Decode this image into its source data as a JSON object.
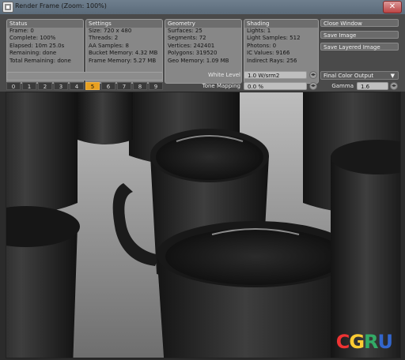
{
  "window": {
    "title": "Render Frame (Zoom: 100%)",
    "close_glyph": "✕"
  },
  "status": {
    "header": "Status",
    "rows": [
      "Frame: 0",
      "Complete: 100%",
      "Elapsed: 10m 25.0s",
      "Remaining: done",
      "Total Remaining: done"
    ]
  },
  "settings": {
    "header": "Settings",
    "rows": [
      "Size: 720 x 480",
      "Threads: 2",
      "AA Samples: 8",
      "Bucket Memory: 4.32 MB",
      "Frame Memory: 5.27 MB"
    ]
  },
  "geometry": {
    "header": "Geometry",
    "rows": [
      "Surfaces: 25",
      "Segments: 72",
      "Vertices: 242401",
      "Polygons: 319520",
      "Geo Memory: 1.09 MB"
    ]
  },
  "shading": {
    "header": "Shading",
    "rows": [
      "Lights: 1",
      "Light Samples: 512",
      "Photons: 0",
      "IC Values: 9166",
      "Indirect Rays: 256"
    ]
  },
  "buttons": {
    "close_window": "Close Window",
    "save_image": "Save Image",
    "save_layered_image": "Save Layered Image"
  },
  "frames": {
    "labels": [
      "0",
      "1",
      "2",
      "3",
      "4",
      "5",
      "6",
      "7",
      "8",
      "9"
    ],
    "selected": "5"
  },
  "progress": {
    "value": 0
  },
  "white_level": {
    "label": "White Level",
    "value": "1.0 W/srm2"
  },
  "tone_mapping": {
    "label": "Tone Mapping",
    "value": "0.0 %"
  },
  "output": {
    "selected": "Final Color Output"
  },
  "gamma": {
    "label": "Gamma",
    "value": "1.6"
  },
  "logo": {
    "letters": [
      "C",
      "G",
      "R",
      "U"
    ]
  },
  "colors": {
    "accent_frame": "#e8a020",
    "panel": "#4a4a4a"
  }
}
